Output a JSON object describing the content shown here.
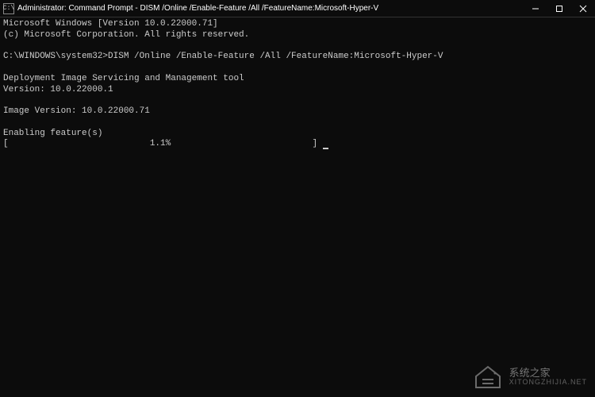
{
  "titlebar": {
    "icon_label": "C:\\",
    "title": "Administrator: Command Prompt - DISM  /Online /Enable-Feature /All /FeatureName:Microsoft-Hyper-V"
  },
  "terminal": {
    "line1": "Microsoft Windows [Version 10.0.22000.71]",
    "line2": "(c) Microsoft Corporation. All rights reserved.",
    "blank1": "",
    "prompt_line": "C:\\WINDOWS\\system32>DISM /Online /Enable-Feature /All /FeatureName:Microsoft-Hyper-V",
    "blank2": "",
    "tool_line": "Deployment Image Servicing and Management tool",
    "version_line": "Version: 10.0.22000.1",
    "blank3": "",
    "image_version": "Image Version: 10.0.22000.71",
    "blank4": "",
    "enabling": "Enabling feature(s)",
    "progress": "[                           1.1%                           ] "
  },
  "watermark": {
    "title": "系统之家",
    "url": "XITONGZHIJIA.NET"
  }
}
